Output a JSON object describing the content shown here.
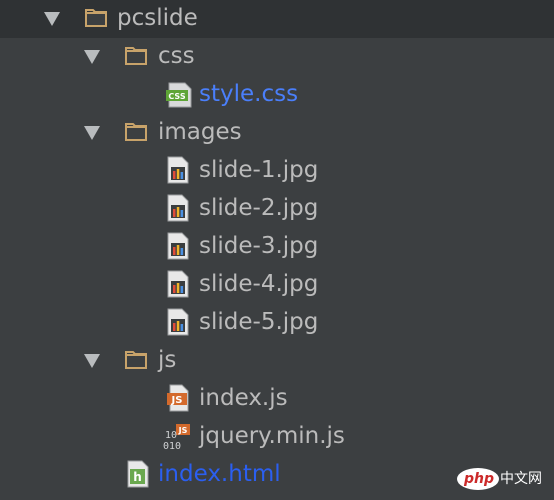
{
  "tree": {
    "root": {
      "label": "pcslide",
      "icon": "folder-icon",
      "expanded": true
    },
    "items": [
      {
        "label": "css",
        "type": "folder",
        "icon": "folder-icon",
        "expanded": true
      },
      {
        "label": "style.css",
        "type": "file",
        "icon": "css-file-icon",
        "badge": "CSS"
      },
      {
        "label": "images",
        "type": "folder",
        "icon": "folder-icon",
        "expanded": true
      },
      {
        "label": "slide-1.jpg",
        "type": "file",
        "icon": "image-file-icon"
      },
      {
        "label": "slide-2.jpg",
        "type": "file",
        "icon": "image-file-icon"
      },
      {
        "label": "slide-3.jpg",
        "type": "file",
        "icon": "image-file-icon"
      },
      {
        "label": "slide-4.jpg",
        "type": "file",
        "icon": "image-file-icon"
      },
      {
        "label": "slide-5.jpg",
        "type": "file",
        "icon": "image-file-icon"
      },
      {
        "label": "js",
        "type": "folder",
        "icon": "folder-icon",
        "expanded": true
      },
      {
        "label": "index.js",
        "type": "file",
        "icon": "js-file-icon",
        "badge": "JS"
      },
      {
        "label": "jquery.min.js",
        "type": "file",
        "icon": "minified-js-file-icon",
        "badge": "JS"
      },
      {
        "label": "index.html",
        "type": "file",
        "icon": "html-file-icon",
        "badge": "h"
      }
    ]
  },
  "watermark": {
    "brand": "php",
    "text": "中文网"
  },
  "colors": {
    "background": "#3c3f41",
    "selected_row": "#2f3234",
    "text": "#bbbbbb",
    "modified_file_text": "#4a7ffb",
    "folder": "#c8a36a",
    "arrow": "#b9bcbe"
  }
}
